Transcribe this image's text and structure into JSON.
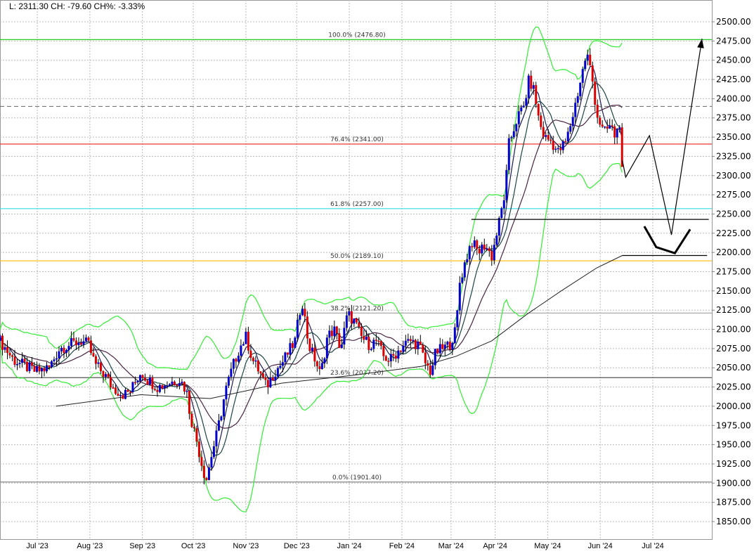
{
  "header": {
    "text": "L: 2311.30 CH: -79.60 CH%: -3.33%"
  },
  "chart_data": {
    "type": "candlestick",
    "title": "",
    "ylim": [
      1850,
      2500
    ],
    "yticks": [
      "2500.00",
      "2475.00",
      "2450.00",
      "2425.00",
      "2400.00",
      "2375.00",
      "2350.00",
      "2325.00",
      "2300.00",
      "2275.00",
      "2250.00",
      "2225.00",
      "2200.00",
      "2175.00",
      "2150.00",
      "2125.00",
      "2100.00",
      "2075.00",
      "2050.00",
      "2025.00",
      "2000.00",
      "1975.00",
      "1950.00",
      "1925.00",
      "1900.00",
      "1875.00",
      "1850.00"
    ],
    "x_unit": "days since 2023-06-15",
    "xlim": [
      -6,
      414
    ],
    "xticks": [
      {
        "label": "Jul '23",
        "day": 16
      },
      {
        "label": "Aug '23",
        "day": 47
      },
      {
        "label": "Sep '23",
        "day": 78
      },
      {
        "label": "Oct '23",
        "day": 108
      },
      {
        "label": "Nov '23",
        "day": 139
      },
      {
        "label": "Dec '23",
        "day": 169
      },
      {
        "label": "Jan '24",
        "day": 200
      },
      {
        "label": "Feb '24",
        "day": 231
      },
      {
        "label": "Mar '24",
        "day": 260
      },
      {
        "label": "Apr '24",
        "day": 286
      },
      {
        "label": "May '24",
        "day": 317
      },
      {
        "label": "Jun '24",
        "day": 348
      },
      {
        "label": "Jul '24",
        "day": 379
      }
    ],
    "last_close": 2311.3,
    "close_anchors": [
      [
        -6,
        2085
      ],
      [
        2,
        2060
      ],
      [
        15,
        2045
      ],
      [
        23,
        2050
      ],
      [
        29,
        2075
      ],
      [
        35,
        2080
      ],
      [
        42,
        2085
      ],
      [
        46,
        2080
      ],
      [
        50,
        2055
      ],
      [
        56,
        2040
      ],
      [
        60,
        2025
      ],
      [
        67,
        2015
      ],
      [
        71,
        2020
      ],
      [
        77,
        2045
      ],
      [
        81,
        2035
      ],
      [
        87,
        2025
      ],
      [
        93,
        2030
      ],
      [
        100,
        2035
      ],
      [
        104,
        2020
      ],
      [
        106,
        1990
      ],
      [
        110,
        1955
      ],
      [
        114,
        1915
      ],
      [
        116,
        1905
      ],
      [
        118,
        1930
      ],
      [
        122,
        1965
      ],
      [
        127,
        2020
      ],
      [
        131,
        2050
      ],
      [
        135,
        2075
      ],
      [
        139,
        2090
      ],
      [
        143,
        2060
      ],
      [
        147,
        2045
      ],
      [
        151,
        2025
      ],
      [
        156,
        2045
      ],
      [
        160,
        2055
      ],
      [
        164,
        2070
      ],
      [
        168,
        2085
      ],
      [
        172,
        2140
      ],
      [
        176,
        2080
      ],
      [
        180,
        2060
      ],
      [
        183,
        2040
      ],
      [
        187,
        2090
      ],
      [
        191,
        2100
      ],
      [
        195,
        2075
      ],
      [
        199,
        2120
      ],
      [
        203,
        2110
      ],
      [
        207,
        2090
      ],
      [
        212,
        2080
      ],
      [
        216,
        2085
      ],
      [
        220,
        2065
      ],
      [
        224,
        2060
      ],
      [
        228,
        2070
      ],
      [
        232,
        2080
      ],
      [
        236,
        2085
      ],
      [
        241,
        2080
      ],
      [
        245,
        2055
      ],
      [
        248,
        2045
      ],
      [
        251,
        2070
      ],
      [
        255,
        2075
      ],
      [
        259,
        2080
      ],
      [
        263,
        2100
      ],
      [
        265,
        2160
      ],
      [
        268,
        2185
      ],
      [
        272,
        2215
      ],
      [
        276,
        2200
      ],
      [
        280,
        2210
      ],
      [
        284,
        2195
      ],
      [
        288,
        2235
      ],
      [
        292,
        2280
      ],
      [
        294,
        2340
      ],
      [
        299,
        2375
      ],
      [
        303,
        2390
      ],
      [
        306,
        2425
      ],
      [
        309,
        2410
      ],
      [
        312,
        2370
      ],
      [
        315,
        2350
      ],
      [
        319,
        2345
      ],
      [
        323,
        2330
      ],
      [
        328,
        2345
      ],
      [
        332,
        2380
      ],
      [
        336,
        2420
      ],
      [
        340,
        2460
      ],
      [
        343,
        2430
      ],
      [
        346,
        2380
      ],
      [
        350,
        2355
      ],
      [
        354,
        2365
      ],
      [
        357,
        2350
      ],
      [
        360,
        2375
      ],
      [
        361,
        2311.3
      ]
    ],
    "moving_averages": [
      {
        "name": "MA5",
        "period": 5,
        "color": "#1c1c55"
      },
      {
        "name": "MA10",
        "period": 10,
        "color": "#1d4545"
      },
      {
        "name": "MA20",
        "period": 20,
        "color": "#4a2445"
      }
    ],
    "bollinger": {
      "period": 20,
      "stddev": 2,
      "color": "#33ee33"
    },
    "long_ma": {
      "color": "#222222",
      "points": [
        [
          27,
          2000
        ],
        [
          77,
          2015
        ],
        [
          118,
          2010
        ],
        [
          160,
          2030
        ],
        [
          201,
          2040
        ],
        [
          243,
          2052
        ],
        [
          263,
          2065
        ],
        [
          284,
          2085
        ],
        [
          305,
          2120
        ],
        [
          325,
          2150
        ],
        [
          346,
          2180
        ],
        [
          361,
          2196
        ]
      ]
    },
    "colors": {
      "up": "#0000cc",
      "down": "#dd0000"
    },
    "fibonacci": [
      {
        "label": "100.0% (2476.80)",
        "value": 2476.8,
        "color": "#22cc22"
      },
      {
        "label": "76.4% (2341.00)",
        "value": 2341.0,
        "color": "#ee2222"
      },
      {
        "label": "61.8% (2257.00)",
        "value": 2257.0,
        "color": "#33dddd"
      },
      {
        "label": "50.0% (2189.10)",
        "value": 2189.1,
        "color": "#ffbb00"
      },
      {
        "label": "38.2% (2121.20)",
        "value": 2121.2,
        "color": "#aaaaaa"
      },
      {
        "label": "23.6% (2037.20)",
        "value": 2037.2,
        "color": "#555555"
      },
      {
        "label": "0.0% (1901.40)",
        "value": 1901.4,
        "color": "#888888"
      }
    ],
    "annotations": {
      "dashed_level": 2390,
      "support_lines": [
        {
          "from": 272,
          "to": 412,
          "value": 2243
        },
        {
          "from": 361,
          "to": 411,
          "value": 2196
        }
      ],
      "projection_thin": [
        [
          361,
          2320
        ],
        [
          363,
          2298
        ],
        [
          377,
          2352
        ],
        [
          390,
          2223
        ],
        [
          408,
          2478
        ]
      ],
      "projection_thick": [
        [
          374,
          2234
        ],
        [
          381,
          2207
        ],
        [
          392,
          2199
        ],
        [
          401,
          2230
        ]
      ]
    }
  }
}
